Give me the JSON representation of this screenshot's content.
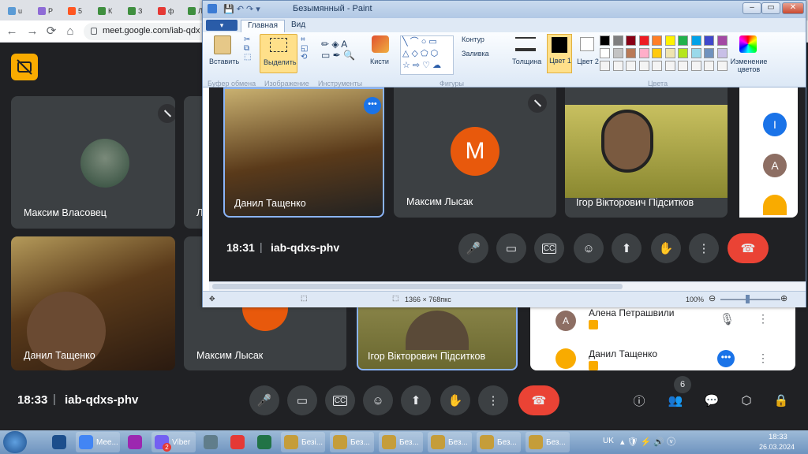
{
  "browser": {
    "tabs": [
      {
        "letter": "u",
        "color": "#5b9bd5"
      },
      {
        "letter": "Р",
        "color": "#8e6bd6"
      },
      {
        "letter": "5",
        "color": "#ff5722"
      },
      {
        "letter": "К",
        "color": "#3f8f3f"
      },
      {
        "letter": "З",
        "color": "#3f8f3f"
      },
      {
        "letter": "ф",
        "color": "#e53935"
      },
      {
        "letter": "Л",
        "color": "#3f8f3f"
      }
    ],
    "url": "meet.google.com/iab-qdx"
  },
  "meet": {
    "tiles": [
      {
        "name": "Максим Власовец"
      },
      {
        "name": "Л"
      },
      {
        "name": "Данил Тащенко"
      },
      {
        "name": "Максим Лысак"
      },
      {
        "name": "Ігор Вікторович Підситков"
      }
    ],
    "time": "18:33",
    "separator": "|",
    "code": "iab-qdxs-phv",
    "people_count": "6",
    "participants": [
      {
        "initial": "А",
        "name": "Алена Петрашвили",
        "color": "#8d6e63"
      },
      {
        "initial": "",
        "name": "Данил Тащенко",
        "color": "#f9ab00"
      }
    ]
  },
  "paint": {
    "title": "Безымянный - Paint",
    "tabs": {
      "file": "▾",
      "home": "Главная",
      "view": "Вид"
    },
    "ribbon": {
      "paste": "Вставить",
      "select": "Выделить",
      "brushes": "Кисти",
      "outline": "Контур",
      "fill": "Заливка",
      "size": "Толщина",
      "color1": "Цвет 1",
      "color2": "Цвет 2",
      "edit_colors": "Изменение цветов"
    },
    "groups": [
      "Буфер обмена",
      "Изображение",
      "Инструменты",
      "Фигуры",
      "Цвета"
    ],
    "palette": [
      "#000000",
      "#7f7f7f",
      "#880015",
      "#ed1c24",
      "#ff7f27",
      "#fff200",
      "#22b14c",
      "#00a2e8",
      "#3f48cc",
      "#a349a4",
      "#ffffff",
      "#c3c3c3",
      "#b97a57",
      "#ffaec9",
      "#ffc90e",
      "#efe4b0",
      "#b5e61d",
      "#99d9ea",
      "#7092be",
      "#c8bfe7"
    ],
    "status_size": "1366 × 768пкс",
    "zoom": "100%",
    "inner_meet": {
      "tiles": [
        {
          "name": "Данил Тащенко"
        },
        {
          "name": "Максим Лысак",
          "initial": "M"
        },
        {
          "name": "Ігор Вікторович Підситков"
        }
      ],
      "time": "18:31",
      "separator": "|",
      "code": "iab-qdxs-phv",
      "participants": [
        {
          "initial": "I",
          "color": "#1a73e8"
        },
        {
          "initial": "А",
          "color": "#8d6e63"
        }
      ]
    }
  },
  "taskbar": {
    "items": [
      {
        "label": "",
        "color": "#1c4e8c"
      },
      {
        "label": "Mee...",
        "color": "#4285f4"
      },
      {
        "label": "",
        "color": "#9c27b0"
      },
      {
        "label": "Viber",
        "color": "#7360f2"
      },
      {
        "label": "",
        "color": "#607d8b"
      },
      {
        "label": "",
        "color": "#e53935"
      },
      {
        "label": "",
        "color": "#217346"
      },
      {
        "label": "Безі...",
        "color": "#c59d3a"
      },
      {
        "label": "Без...",
        "color": "#c59d3a"
      },
      {
        "label": "Без...",
        "color": "#c59d3a"
      },
      {
        "label": "Без...",
        "color": "#c59d3a"
      },
      {
        "label": "Без...",
        "color": "#c59d3a"
      },
      {
        "label": "Без...",
        "color": "#c59d3a"
      }
    ],
    "viber_badge": "2",
    "lang": "UK",
    "time": "18:33",
    "date": "26.03.2024"
  }
}
